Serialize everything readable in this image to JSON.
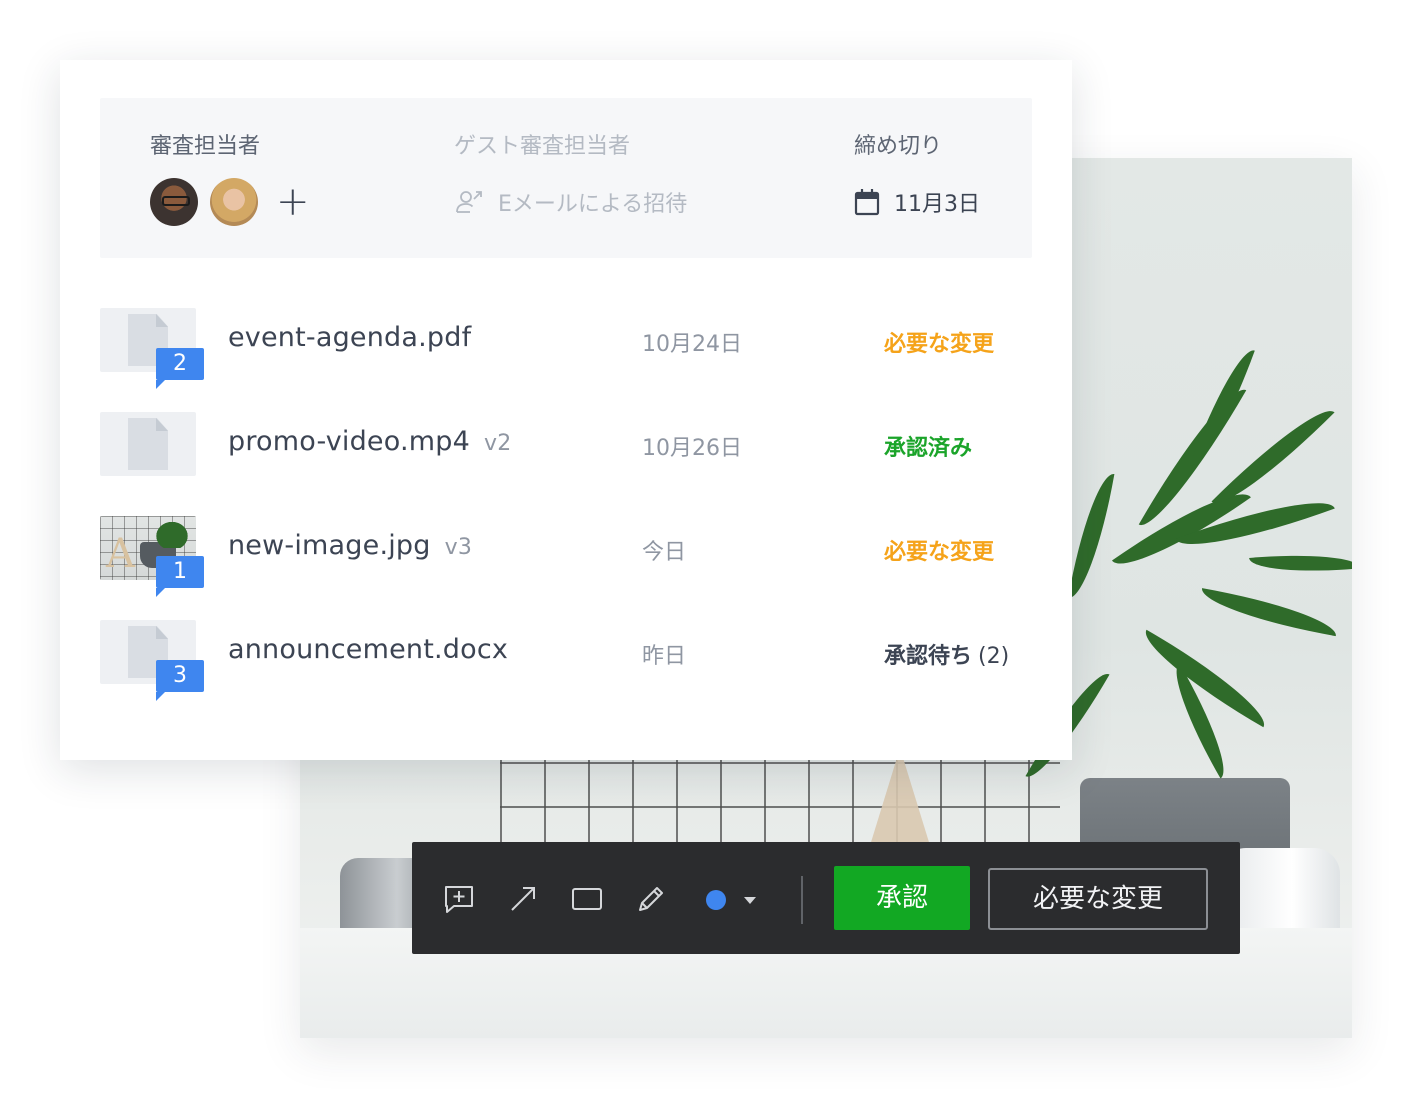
{
  "review": {
    "reviewers_label": "審査担当者",
    "add_reviewer": "+",
    "guest_reviewers_label": "ゲスト審査担当者",
    "guest_invite": "Eメールによる招待",
    "deadline_label": "締め切り",
    "deadline_value": "11月3日"
  },
  "files": [
    {
      "name": "event-agenda.pdf",
      "version": "",
      "comments": "2",
      "date": "10月24日",
      "status": "必要な変更",
      "status_count": "",
      "thumb": "document"
    },
    {
      "name": "promo-video.mp4",
      "version": "v2",
      "comments": "",
      "date": "10月26日",
      "status": "承認済み",
      "status_count": "",
      "thumb": "document"
    },
    {
      "name": "new-image.jpg",
      "version": "v3",
      "comments": "1",
      "date": "今日",
      "status": "必要な変更",
      "status_count": "",
      "thumb": "image"
    },
    {
      "name": "announcement.docx",
      "version": "",
      "comments": "3",
      "date": "昨日",
      "status": "承認待ち",
      "status_count": "(2)",
      "thumb": "document"
    }
  ],
  "toolbar": {
    "tools": [
      "comment-icon",
      "arrow-icon",
      "rectangle-icon",
      "pencil-icon"
    ],
    "selected_color": "#3f86ef",
    "approve_label": "承認",
    "changes_label": "必要な変更"
  },
  "colors": {
    "status_changes": "#f5a31a",
    "status_approved": "#1ba42a",
    "badge": "#3f86ef",
    "approve_button": "#12a823",
    "toolbar_bg": "#2b2c2e"
  }
}
